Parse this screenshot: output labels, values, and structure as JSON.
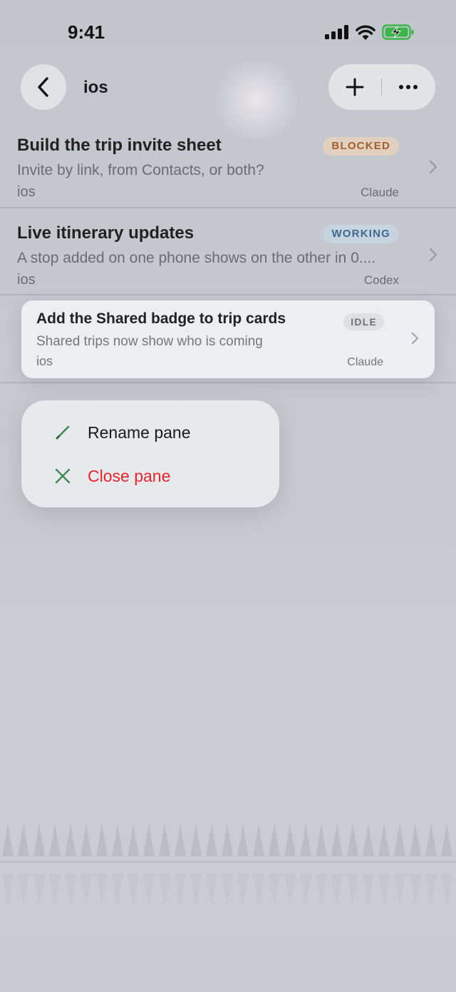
{
  "status": {
    "time": "9:41"
  },
  "nav": {
    "title": "ios"
  },
  "rows": [
    {
      "title": "Build the trip invite sheet",
      "subtitle": "Invite by link, from Contacts, or both?",
      "repo": "ios",
      "agent": "Claude",
      "badge": "BLOCKED"
    },
    {
      "title": "Live itinerary updates",
      "subtitle": "A stop added on one phone shows on the other in 0....",
      "repo": "ios",
      "agent": "Codex",
      "badge": "WORKING"
    }
  ],
  "selected_card": {
    "title": "Add the Shared badge to trip cards",
    "subtitle": "Shared trips now show who is coming",
    "repo": "ios",
    "agent": "Claude",
    "badge": "IDLE"
  },
  "menu": {
    "rename_label": "Rename pane",
    "close_label": "Close pane"
  },
  "colors": {
    "blocked_bg": "#e1cfbf",
    "blocked_text": "#a45f2a",
    "working_bg": "#c7d3de",
    "working_text": "#3c6a90",
    "idle_bg": "#dfe0e3",
    "idle_text": "#6e7075",
    "menu_icon": "#3f8a57",
    "destructive": "#e0262b"
  }
}
